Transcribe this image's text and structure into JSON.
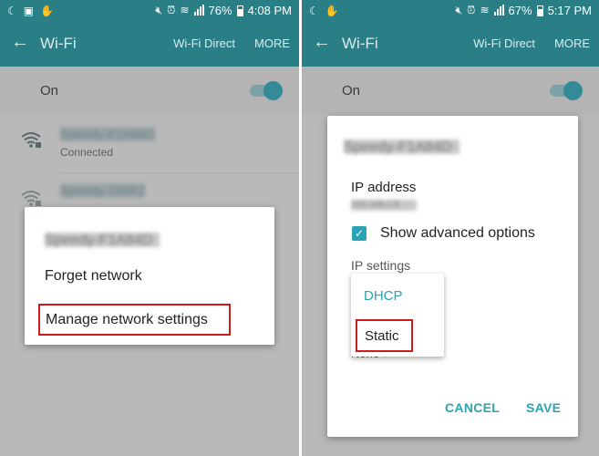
{
  "colors": {
    "accent": "#2aa3b4",
    "appbar": "#2a7f86",
    "highlight": "#cc1b1b"
  },
  "left": {
    "status": {
      "battery": "76%",
      "time": "4:08 PM"
    },
    "appbar": {
      "back_icon": "arrow-left-icon",
      "title": "Wi-Fi",
      "action_direct": "Wi-Fi Direct",
      "action_more": "MORE"
    },
    "toggle_row": {
      "label": "On",
      "on": true
    },
    "networks": [
      {
        "ssid": "Speedy-F1A84D",
        "status": "Connected"
      },
      {
        "ssid": "Speedy-7A5F2"
      }
    ],
    "menu": {
      "network_name": "Speedy-F1A84D",
      "items": [
        "Forget network",
        "Manage network settings"
      ]
    }
  },
  "right": {
    "status": {
      "battery": "67%",
      "time": "5:17 PM"
    },
    "appbar": {
      "back_icon": "arrow-left-icon",
      "title": "Wi-Fi",
      "action_direct": "Wi-Fi Direct",
      "action_more": "MORE"
    },
    "toggle_row": {
      "label": "On",
      "on": true
    },
    "dialog": {
      "network_name": "Speedy-F1A84D",
      "ip_address_label": "IP address",
      "ip_address_value": "192.168.1.5",
      "advanced_label": "Show advanced options",
      "advanced_checked": true,
      "ip_settings_label": "IP settings",
      "proxy_value": "None",
      "cancel": "CANCEL",
      "save": "SAVE"
    },
    "dropdown": {
      "options": [
        "DHCP",
        "Static"
      ],
      "selected": "Static"
    }
  }
}
